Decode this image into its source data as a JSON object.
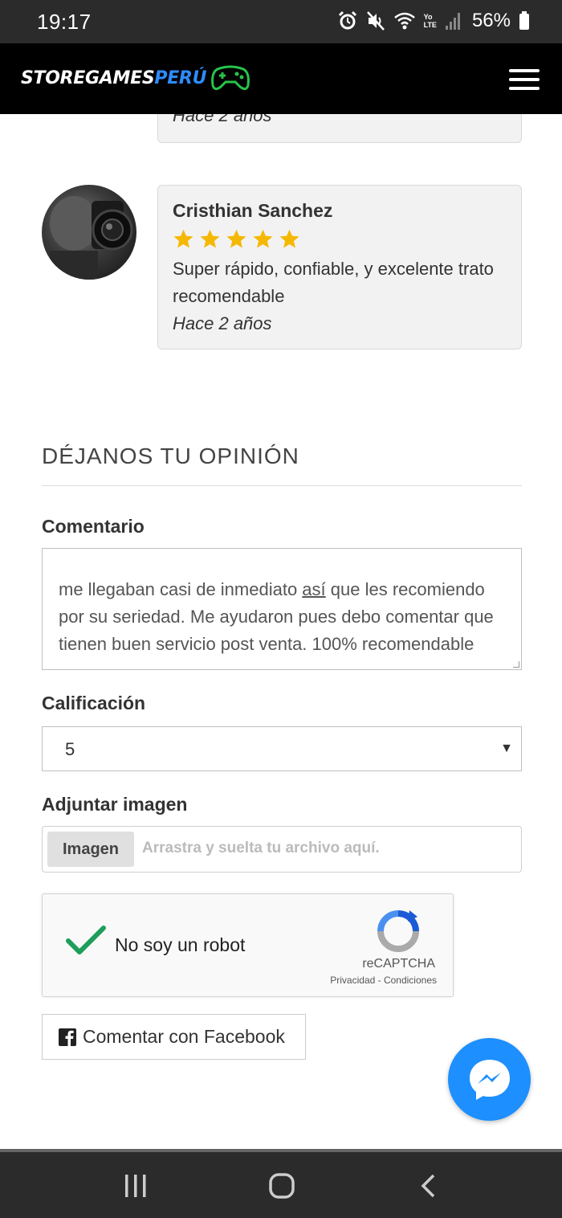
{
  "status_bar": {
    "time": "19:17",
    "lte_label_top": "Yo",
    "lte_label_bottom": "LTE",
    "battery": "56%"
  },
  "navbar": {
    "brand_main": "STOREGAMES",
    "brand_accent": "PERÚ",
    "brand_accent_color": "#2e8cff",
    "logo_icon": "gamepad-icon",
    "menu_icon": "hamburger-icon"
  },
  "reviews": [
    {
      "when": "Hace 2 años"
    },
    {
      "name": "Cristhian Sanchez",
      "stars": 5,
      "text": "Super rápido, confiable, y excelente trato recomendable",
      "when": "Hace 2 años"
    }
  ],
  "form": {
    "title": "DÉJANOS TU OPINIÓN",
    "comment_label": "Comentario",
    "comment_value_line1": "me llegaban casi de inmediato ",
    "comment_value_underlined": "así",
    "comment_value_line1_end": " que les",
    "comment_value_rest": "recomiendo por su seriedad. Me ayudaron pues debo comentar que tienen buen servicio post venta. 100% recomendable",
    "rating_label": "Calificación",
    "rating_value": "5",
    "image_label": "Adjuntar imagen",
    "image_button": "Imagen",
    "image_placeholder": "Arrastra y suelta tu archivo aquí.",
    "captcha_text": "No soy un robot",
    "captcha_brand": "reCAPTCHA",
    "captcha_links": "Privacidad - Condiciones",
    "facebook_button": "Comentar con Facebook"
  },
  "colors": {
    "star": "#f5b800",
    "check": "#1e9e5a",
    "messenger": "#1d8fff"
  }
}
